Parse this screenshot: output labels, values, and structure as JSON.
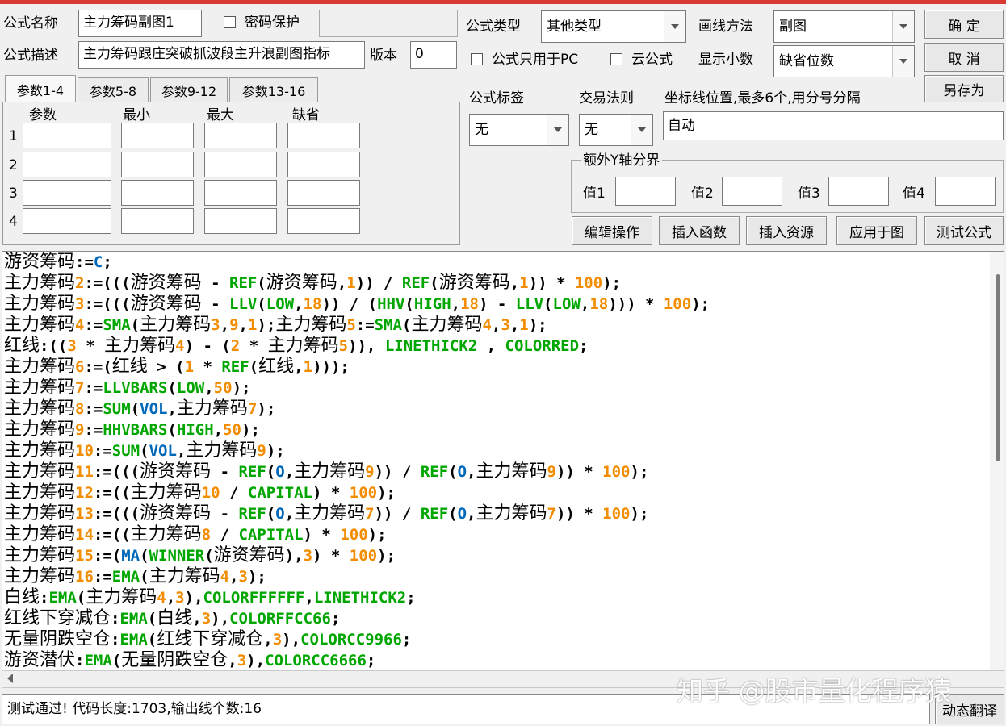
{
  "form": {
    "name_label": "公式名称",
    "name_value": "主力筹码副图1",
    "password_label": "密码保护",
    "password_value": "",
    "desc_label": "公式描述",
    "desc_value": "主力筹码跟庄突破抓波段主升浪副图指标",
    "version_label": "版本",
    "version_value": "0",
    "type_label": "公式类型",
    "type_value": "其他类型",
    "draw_label": "画线方法",
    "draw_value": "副图",
    "pc_only_label": "公式只用于PC",
    "cloud_label": "云公式",
    "decimal_label": "显示小数",
    "decimal_value": "缺省位数",
    "tag_label": "公式标签",
    "tag_value": "无",
    "trade_label": "交易法则",
    "trade_value": "无",
    "axis_label": "坐标线位置,最多6个,用分号分隔",
    "axis_value": "自动",
    "extra_y_label": "额外Y轴分界",
    "val1_label": "值1",
    "val2_label": "值2",
    "val3_label": "值3",
    "val4_label": "值4"
  },
  "buttons": {
    "ok": "确  定",
    "cancel": "取  消",
    "save_as": "另存为",
    "edit_ops": "编辑操作",
    "insert_func": "插入函数",
    "insert_res": "插入资源",
    "apply_chart": "应用于图",
    "test_formula": "测试公式",
    "dyn_translate": "动态翻译"
  },
  "tabs": [
    "参数1-4",
    "参数5-8",
    "参数9-12",
    "参数13-16"
  ],
  "param_headers": [
    "参数",
    "最小",
    "最大",
    "缺省"
  ],
  "param_rows": [
    "1",
    "2",
    "3",
    "4"
  ],
  "status_text": "测试通过! 代码长度:1703,输出线个数:16",
  "watermark": "知乎 @股市量化程序猿",
  "colors": {
    "accent_bar": "#d93a32",
    "func": "#00a600",
    "number": "#f28c00",
    "var": "#0068b8"
  },
  "code_lines": [
    "游资筹码:=C;",
    "主力筹码2:=(((游资筹码 - REF(游资筹码,1)) / REF(游资筹码,1)) * 100);",
    "主力筹码3:=(((游资筹码 - LLV(LOW,18)) / (HHV(HIGH,18) - LLV(LOW,18))) * 100);",
    "主力筹码4:=SMA(主力筹码3,9,1);主力筹码5:=SMA(主力筹码4,3,1);",
    "红线:((3 * 主力筹码4) - (2 * 主力筹码5)), LINETHICK2 , COLORRED;",
    "主力筹码6:=(红线 > (1 * REF(红线,1)));",
    "主力筹码7:=LLVBARS(LOW,50);",
    "主力筹码8:=SUM(VOL,主力筹码7);",
    "主力筹码9:=HHVBARS(HIGH,50);",
    "主力筹码10:=SUM(VOL,主力筹码9);",
    "主力筹码11:=(((游资筹码 - REF(O,主力筹码9)) / REF(O,主力筹码9)) * 100);",
    "主力筹码12:=((主力筹码10 / CAPITAL) * 100);",
    "主力筹码13:=(((游资筹码 - REF(O,主力筹码7)) / REF(O,主力筹码7)) * 100);",
    "主力筹码14:=((主力筹码8 / CAPITAL) * 100);",
    "主力筹码15:=(MA(WINNER(游资筹码),3) * 100);",
    "主力筹码16:=EMA(主力筹码4,3);",
    "白线:EMA(主力筹码4,3),COLORFFFFFF,LINETHICK2;",
    "红线下穿减仓:EMA(白线,3),COLORFFCC66;",
    "无量阴跌空仓:EMA(红线下穿减仓,3),COLORCC9966;",
    "游资潜伏:EMA(无量阴跌空仓,3),COLORCC6666;"
  ]
}
